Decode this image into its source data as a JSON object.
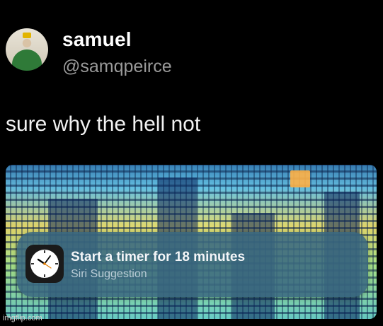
{
  "post": {
    "display_name": "samuel",
    "handle": "@samqpeirce",
    "text": "sure why the hell not",
    "avatar_icon": "user-avatar"
  },
  "siri_suggestion": {
    "title": "Start a timer for 18 minutes",
    "subtitle": "Siri Suggestion",
    "icon": "clock-icon"
  },
  "watermark": "imgflip.com"
}
